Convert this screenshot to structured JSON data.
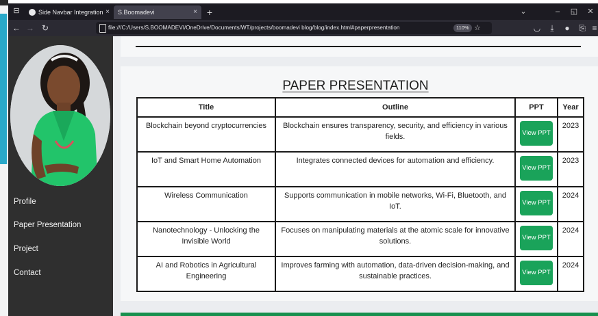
{
  "browser": {
    "tabs": [
      {
        "title": "Side Navbar Integration",
        "close": "×"
      },
      {
        "title": "S.Boomadevi",
        "close": "×"
      }
    ],
    "new_tab": "+",
    "url": "file:///C:/Users/S.BOOMADEVI/OneDrive/Documents/WT/projects/boomadevi blog/blog/index.html#paperpresentation",
    "zoom": "110%"
  },
  "sidebar": {
    "items": [
      {
        "label": "Profile"
      },
      {
        "label": "Paper Presentation"
      },
      {
        "label": "Project"
      },
      {
        "label": "Contact"
      }
    ]
  },
  "main": {
    "heading": "PAPER PRESENTATION",
    "table": {
      "headers": [
        "Title",
        "Outline",
        "PPT",
        "Year"
      ],
      "rows": [
        {
          "title": "Blockchain beyond cryptocurrencies",
          "outline": "Blockchain ensures transparency, security, and efficiency in various fields.",
          "button": "View PPT",
          "year": "2023"
        },
        {
          "title": "IoT and Smart Home Automation",
          "outline": "Integrates connected devices for automation and efficiency.",
          "button": "View PPT",
          "year": "2023"
        },
        {
          "title": "Wireless Communication",
          "outline": "Supports communication in mobile networks, Wi-Fi, Bluetooth, and IoT.",
          "button": "View PPT",
          "year": "2024"
        },
        {
          "title": "Nanotechnology - Unlocking the Invisible World",
          "outline": "Focuses on manipulating materials at the atomic scale for innovative solutions.",
          "button": "View PPT",
          "year": "2024"
        },
        {
          "title": "AI and Robotics in Agricultural Engineering",
          "outline": "Improves farming with automation, data-driven decision-making, and sustainable practices.",
          "button": "View PPT",
          "year": "2024"
        }
      ]
    }
  },
  "colors": {
    "sidebar_bg": "#2f2f2f",
    "button_green": "#1aa35a",
    "browser_titlebar": "#1c1b22",
    "browser_navbar": "#2b2a33"
  }
}
